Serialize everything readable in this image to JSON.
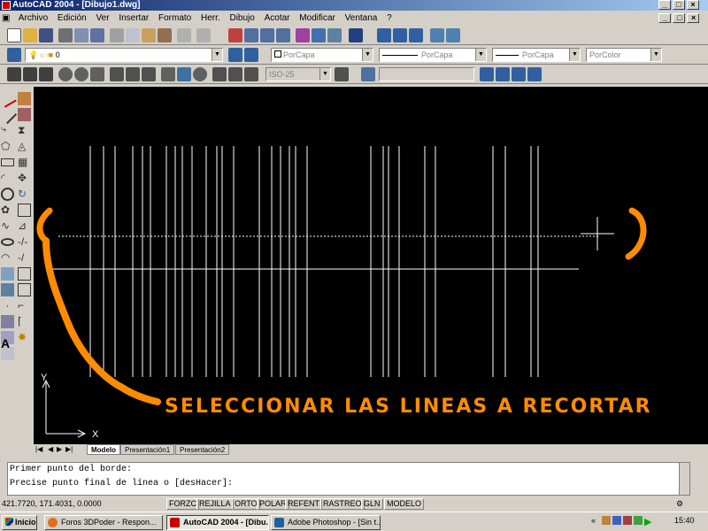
{
  "window": {
    "title": "AutoCAD 2004 - [Dibujo1.dwg]",
    "buttons": [
      "_",
      "□",
      "×"
    ]
  },
  "menu": [
    "Archivo",
    "Edición",
    "Ver",
    "Insertar",
    "Formato",
    "Herr.",
    "Dibujo",
    "Acotar",
    "Modificar",
    "Ventana",
    "?"
  ],
  "layer": {
    "value": "0"
  },
  "props": {
    "color": "PorCapa",
    "linetype": "PorCapa",
    "lineweight": "PorCapa",
    "plotstyle": "PorColor"
  },
  "dimstyle": "ISO-25",
  "annotation": "SELECCIONAR LAS LINEAS A RECORTAR",
  "ucs": {
    "y": "Y",
    "x": "X"
  },
  "tabs": [
    "Modelo",
    "Presentación1",
    "Presentación2"
  ],
  "command": [
    "Primer punto del borde:",
    "Precise punto final de línea o [desHacer]:"
  ],
  "coords": "421.7720, 171.4031, 0.0000",
  "status_buttons": [
    "FORZC",
    "REJILLA",
    "ORTO",
    "POLAR",
    "REFENT",
    "RASTREO",
    "GLN",
    "MODELO"
  ],
  "taskbar": {
    "start": "Inicio",
    "items": [
      "Foros 3DPoder - Respon...",
      "AutoCAD 2004 - [Dibu...",
      "Adobe Photoshop - [Sin t..."
    ],
    "clock": "15:40"
  },
  "colors": {
    "annotation": "#ff8c00",
    "canvas": "#000000",
    "title_start": "#0a246a"
  }
}
